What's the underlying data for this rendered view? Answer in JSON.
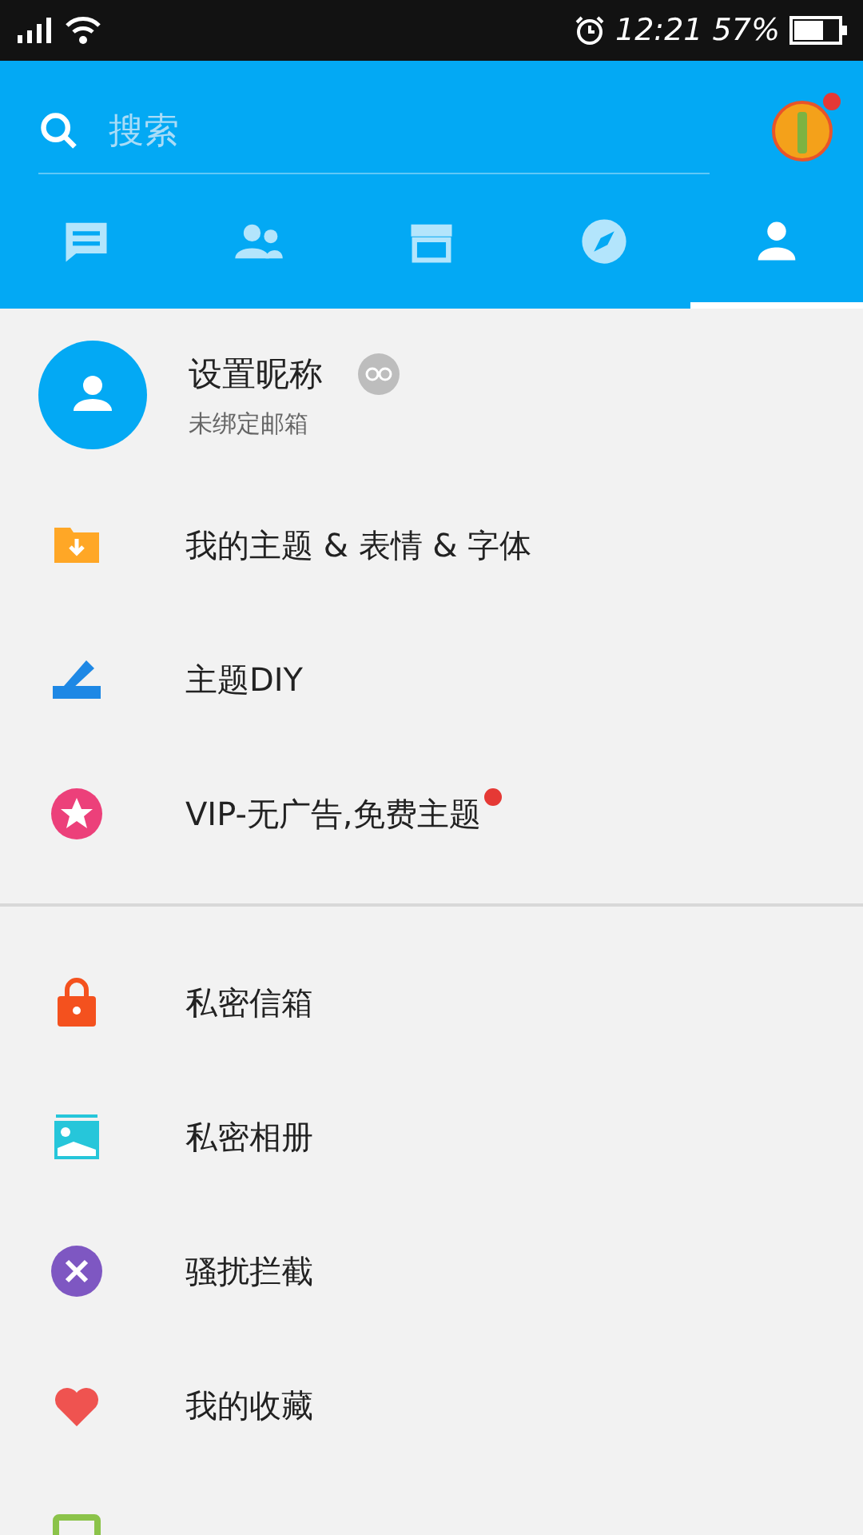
{
  "status_bar": {
    "time": "12:21",
    "battery": "57%"
  },
  "search": {
    "placeholder": "搜索",
    "avatar_badge": true
  },
  "tabs": [
    {
      "kind": "messages",
      "selected": false
    },
    {
      "kind": "contacts",
      "selected": false
    },
    {
      "kind": "store",
      "selected": false
    },
    {
      "kind": "discover",
      "selected": false
    },
    {
      "kind": "profile",
      "selected": true
    }
  ],
  "profile": {
    "name": "设置昵称",
    "subtitle": "未绑定邮箱"
  },
  "menu_groups": [
    [
      {
        "kind": "folder",
        "label": "我的主题 & 表情 & 字体",
        "badge": false
      },
      {
        "kind": "pencil",
        "label": "主题DIY",
        "badge": false
      },
      {
        "kind": "star",
        "label": "VIP-无广告,免费主题",
        "badge": true
      }
    ],
    [
      {
        "kind": "lock",
        "label": "私密信箱",
        "badge": false
      },
      {
        "kind": "photo",
        "label": "私密相册",
        "badge": false
      },
      {
        "kind": "block",
        "label": "骚扰拦截",
        "badge": false
      },
      {
        "kind": "heart",
        "label": "我的收藏",
        "badge": false
      },
      {
        "kind": "document",
        "badge": false
      }
    ]
  ]
}
